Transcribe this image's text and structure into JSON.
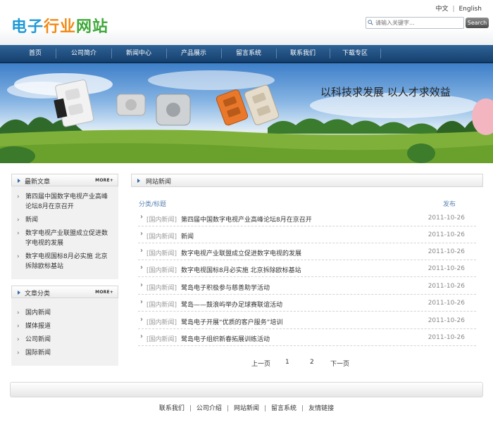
{
  "header": {
    "logo": [
      "电子",
      "行业",
      "网站"
    ],
    "logo_colors": [
      "#1f9ad6",
      "#f28a13",
      "#3fa83a"
    ],
    "lang": {
      "cn": "中文",
      "sep": "|",
      "en": "English"
    },
    "search": {
      "placeholder": "请输入关键字...",
      "button": "Search"
    }
  },
  "nav": {
    "items": [
      "首页",
      "公司简介",
      "新闻中心",
      "产品展示",
      "留言系统",
      "联系我们",
      "下载专区"
    ],
    "bg_color": "#1f4f80"
  },
  "banner": {
    "slogan": "以科技求发展  以人才求效益"
  },
  "sidebar": {
    "latest": {
      "title": "最新文章",
      "more": "MORE+",
      "items": [
        "第四届中国数字电视产业高峰论坛8月在京召开",
        "新闻",
        "数字电视产业联盟成立促进数字电视的发展",
        "数字电视国标8月必实施 北京拆除欧标基站"
      ]
    },
    "categories": {
      "title": "文章分类",
      "more": "MORE+",
      "items": [
        "国内新闻",
        "媒体报道",
        "公司新闻",
        "国际新闻"
      ]
    }
  },
  "main": {
    "title": "网站新闻",
    "col_category_title": "分类/标题",
    "col_published": "发布",
    "rows": [
      {
        "cat": "[国内新闻]",
        "title": "第四届中国数字电视产业高峰论坛8月在京召开",
        "date": "2011-10-26"
      },
      {
        "cat": "[国内新闻]",
        "title": "新闻",
        "date": "2011-10-26"
      },
      {
        "cat": "[国内新闻]",
        "title": "数字电视产业联盟成立促进数字电视的发展",
        "date": "2011-10-26"
      },
      {
        "cat": "[国内新闻]",
        "title": "数字电视国标8月必实施 北京拆除欧标基站",
        "date": "2011-10-26"
      },
      {
        "cat": "[国内新闻]",
        "title": "鹭岛电子积极参与慈善助学活动",
        "date": "2011-10-26"
      },
      {
        "cat": "[国内新闻]",
        "title": "鹭岛——鼓浪屿举办足球赛联谊活动",
        "date": "2011-10-26"
      },
      {
        "cat": "[国内新闻]",
        "title": "鹭岛电子开展“优质的客户服务”培训",
        "date": "2011-10-26"
      },
      {
        "cat": "[国内新闻]",
        "title": "鹭岛电子组织新春拓展训练活动",
        "date": "2011-10-26"
      }
    ],
    "pager": {
      "prev": "上一页",
      "pages": [
        "1",
        "2"
      ],
      "next": "下一页"
    }
  },
  "footer": {
    "links": [
      "联系我们",
      "公司介绍",
      "网站新闻",
      "留言系统",
      "友情链接"
    ],
    "sep": "|"
  }
}
